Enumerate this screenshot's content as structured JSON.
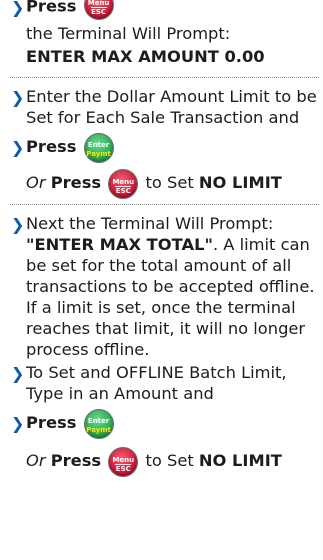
{
  "keys": {
    "menu_top": "Menu",
    "menu_bottom": "ESC",
    "enter_top": "Enter",
    "enter_bottom": "Paymt"
  },
  "section1": {
    "press": "Press",
    "line1": "the Terminal Will Prompt:",
    "line2": "ENTER MAX AMOUNT 0.00"
  },
  "section2": {
    "step1": "Enter the Dollar Amount Limit to be Set for Each Sale Transaction and",
    "press": "Press",
    "or": "Or",
    "or_press": "Press",
    "to_set": "to Set",
    "no_limit": "NO LIMIT"
  },
  "section3": {
    "step1_a": "Next the Terminal Will Prompt:",
    "step1_b": "\"ENTER MAX TOTAL\"",
    "step1_c": ". A limit can be set for the total amount of all transactions to be accepted offline. If a limit is set, once the terminal reaches that limit, it will no longer process offline.",
    "step2": "To Set and OFFLINE Batch Limit, Type in an Amount and",
    "press": "Press",
    "or": "Or",
    "or_press": "Press",
    "to_set": "to Set",
    "no_limit": "NO LIMIT"
  },
  "colors": {
    "bullet": "#0d5aa8",
    "menu_key": "#c8102e",
    "enter_key": "#1ea34b"
  }
}
